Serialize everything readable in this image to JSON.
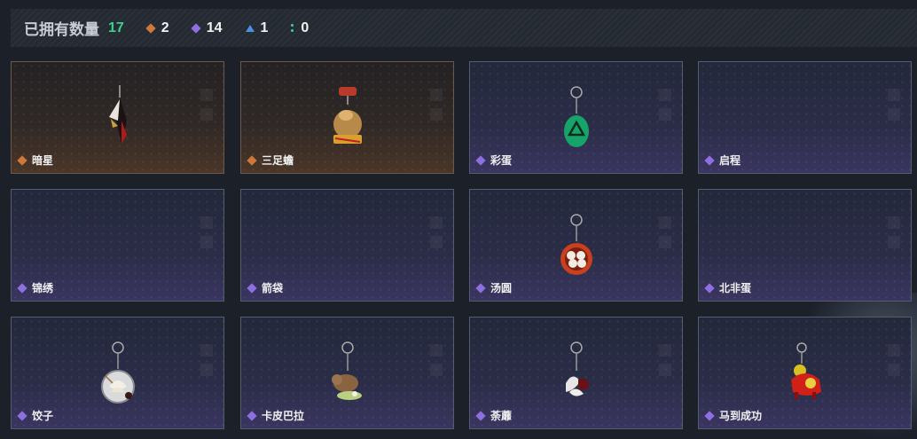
{
  "header": {
    "title": "已拥有数量",
    "total": "17",
    "total_color": "#3ecf8e",
    "stats": [
      {
        "icon": "orange-gem-icon",
        "value": "2",
        "color": "#d0783a"
      },
      {
        "icon": "purple-gem-icon",
        "value": "14",
        "color": "#8e6fe0"
      },
      {
        "icon": "blue-triangle-icon",
        "value": "1",
        "color": "#4f8fe0"
      },
      {
        "icon": "green-dots-icon",
        "value": "0",
        "color": "#3ecfa0"
      }
    ]
  },
  "items": [
    {
      "name": "暗星",
      "rarity": "orange",
      "icon": "dark-star-charm-icon"
    },
    {
      "name": "三足蟾",
      "rarity": "orange",
      "icon": "three-legged-toad-charm-icon"
    },
    {
      "name": "彩蛋",
      "rarity": "purple",
      "icon": "easter-egg-charm-icon"
    },
    {
      "name": "启程",
      "rarity": "purple",
      "icon": "empty-slot-icon"
    },
    {
      "name": "锦绣",
      "rarity": "purple",
      "icon": "empty-slot-icon"
    },
    {
      "name": "箭袋",
      "rarity": "purple",
      "icon": "empty-slot-icon"
    },
    {
      "name": "汤圆",
      "rarity": "purple",
      "icon": "tangyuan-bowl-charm-icon"
    },
    {
      "name": "北非蛋",
      "rarity": "purple",
      "icon": "empty-slot-icon"
    },
    {
      "name": "饺子",
      "rarity": "purple",
      "icon": "dumpling-plate-charm-icon"
    },
    {
      "name": "卡皮巴拉",
      "rarity": "purple",
      "icon": "capybara-charm-icon"
    },
    {
      "name": "荼蘼",
      "rarity": "purple",
      "icon": "flower-charm-icon"
    },
    {
      "name": "马到成功",
      "rarity": "purple",
      "icon": "horse-charm-icon"
    }
  ]
}
